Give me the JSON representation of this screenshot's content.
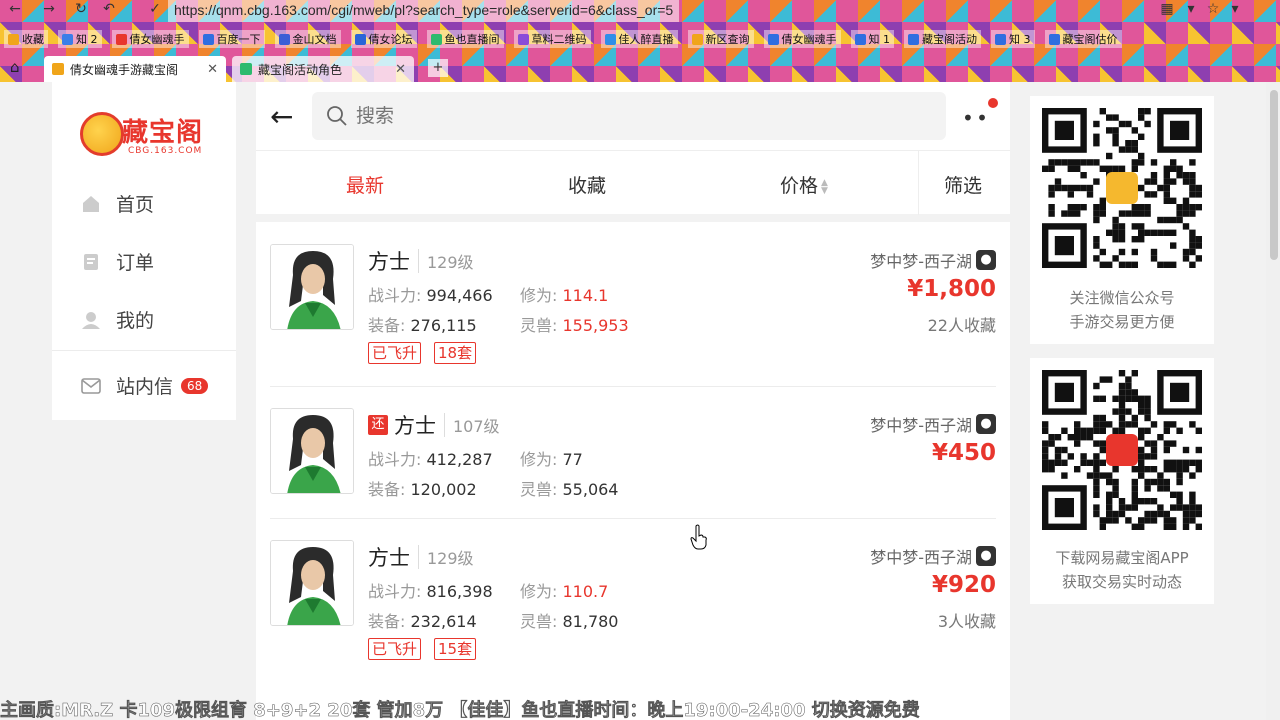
{
  "browser": {
    "url": "https://qnm.cbg.163.com/cgi/mweb/pl?search_type=role&serverid=6&class_or=5",
    "bookmarks": [
      "收藏",
      "知 2",
      "倩女幽魂手",
      "百度一下",
      "金山文档",
      "倩女论坛",
      "鱼也直播间",
      "草料二维码",
      "佳人醉直播",
      "新区查询",
      "倩女幽魂手",
      "知 1",
      "藏宝阁活动",
      "知 3",
      "藏宝阁估价"
    ],
    "tabs": [
      {
        "label": "倩女幽魂手游藏宝阁",
        "active": true
      },
      {
        "label": "藏宝阁活动角色",
        "active": false
      }
    ]
  },
  "sidebar": {
    "logo_text": "藏宝阁",
    "logo_sub": "CBG.163.COM",
    "items": [
      {
        "label": "首页",
        "icon": "home-icon"
      },
      {
        "label": "订单",
        "icon": "order-icon"
      },
      {
        "label": "我的",
        "icon": "user-icon"
      },
      {
        "label": "站内信",
        "icon": "mail-icon",
        "badge": "68"
      }
    ]
  },
  "header": {
    "search_placeholder": "搜索"
  },
  "filters": {
    "tabs": [
      "最新",
      "收藏",
      "价格",
      "筛选"
    ],
    "active": "最新"
  },
  "listings": [
    {
      "name": "方士",
      "level": "129级",
      "returning": false,
      "power_label": "战斗力:",
      "power": "994,466",
      "xiuwei_label": "修为:",
      "xiuwei": "114.1",
      "equip_label": "装备:",
      "equip": "276,115",
      "pet_label": "灵兽:",
      "pet": "155,953",
      "tags": [
        "已飞升",
        "18套"
      ],
      "server": "梦中梦-西子湖",
      "price": "¥1,800",
      "favorites": "22人收藏"
    },
    {
      "name": "方士",
      "level": "107级",
      "returning": true,
      "return_badge": "还",
      "power_label": "战斗力:",
      "power": "412,287",
      "xiuwei_label": "修为:",
      "xiuwei": "77",
      "equip_label": "装备:",
      "equip": "120,002",
      "pet_label": "灵兽:",
      "pet": "55,064",
      "tags": [],
      "server": "梦中梦-西子湖",
      "price": "¥450",
      "favorites": ""
    },
    {
      "name": "方士",
      "level": "129级",
      "returning": false,
      "power_label": "战斗力:",
      "power": "816,398",
      "xiuwei_label": "修为:",
      "xiuwei": "110.7",
      "equip_label": "装备:",
      "equip": "232,614",
      "pet_label": "灵兽:",
      "pet": "81,780",
      "tags": [
        "已飞升",
        "15套"
      ],
      "server": "梦中梦-西子湖",
      "price": "¥920",
      "favorites": "3人收藏"
    }
  ],
  "qr_cards": [
    {
      "caption_line1": "关注微信公众号",
      "caption_line2": "手游交易更方便"
    },
    {
      "caption_line1": "下载网易藏宝阁APP",
      "caption_line2": "获取交易实时动态"
    }
  ],
  "ticker": "主画质:MR.Z 卡109极限组育 8+9+2 20套 管加8万 【佳佳】鱼也直播时间：晚上19:00-24:00 切换资源免费"
}
